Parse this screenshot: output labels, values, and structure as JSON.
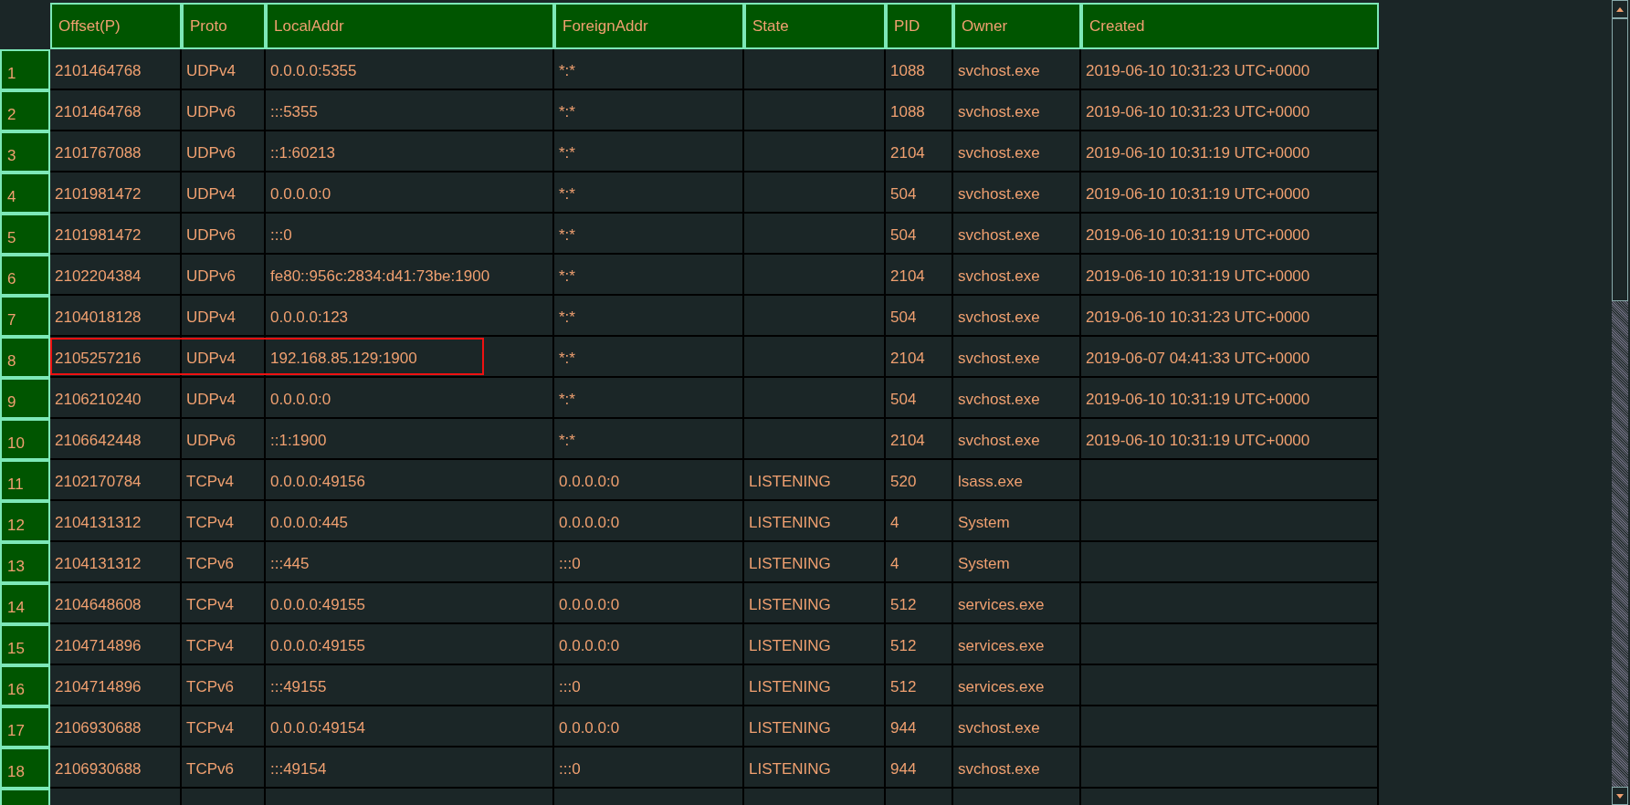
{
  "table": {
    "columns": [
      "Offset(P)",
      "Proto",
      "LocalAddr",
      "ForeignAddr",
      "State",
      "PID",
      "Owner",
      "Created"
    ],
    "rows": [
      {
        "number": "1",
        "cells": [
          "2101464768",
          "UDPv4",
          "0.0.0.0:5355",
          "*:*",
          "",
          "1088",
          "svchost.exe",
          "2019-06-10 10:31:23 UTC+0000"
        ],
        "highlighted": false
      },
      {
        "number": "2",
        "cells": [
          "2101464768",
          "UDPv6",
          ":::5355",
          "*:*",
          "",
          "1088",
          "svchost.exe",
          "2019-06-10 10:31:23 UTC+0000"
        ],
        "highlighted": false
      },
      {
        "number": "3",
        "cells": [
          "2101767088",
          "UDPv6",
          "::1:60213",
          "*:*",
          "",
          "2104",
          "svchost.exe",
          "2019-06-10 10:31:19 UTC+0000"
        ],
        "highlighted": false
      },
      {
        "number": "4",
        "cells": [
          "2101981472",
          "UDPv4",
          "0.0.0.0:0",
          "*:*",
          "",
          "504",
          "svchost.exe",
          "2019-06-10 10:31:19 UTC+0000"
        ],
        "highlighted": false
      },
      {
        "number": "5",
        "cells": [
          "2101981472",
          "UDPv6",
          ":::0",
          "*:*",
          "",
          "504",
          "svchost.exe",
          "2019-06-10 10:31:19 UTC+0000"
        ],
        "highlighted": false
      },
      {
        "number": "6",
        "cells": [
          "2102204384",
          "UDPv6",
          "fe80::956c:2834:d41:73be:1900",
          "*:*",
          "",
          "2104",
          "svchost.exe",
          "2019-06-10 10:31:19 UTC+0000"
        ],
        "highlighted": false
      },
      {
        "number": "7",
        "cells": [
          "2104018128",
          "UDPv4",
          "0.0.0.0:123",
          "*:*",
          "",
          "504",
          "svchost.exe",
          "2019-06-10 10:31:23 UTC+0000"
        ],
        "highlighted": false
      },
      {
        "number": "8",
        "cells": [
          "2105257216",
          "UDPv4",
          "192.168.85.129:1900",
          "*:*",
          "",
          "2104",
          "svchost.exe",
          "2019-06-07 04:41:33 UTC+0000"
        ],
        "highlighted": true
      },
      {
        "number": "9",
        "cells": [
          "2106210240",
          "UDPv4",
          "0.0.0.0:0",
          "*:*",
          "",
          "504",
          "svchost.exe",
          "2019-06-10 10:31:19 UTC+0000"
        ],
        "highlighted": false
      },
      {
        "number": "10",
        "cells": [
          "2106642448",
          "UDPv6",
          "::1:1900",
          "*:*",
          "",
          "2104",
          "svchost.exe",
          "2019-06-10 10:31:19 UTC+0000"
        ],
        "highlighted": false
      },
      {
        "number": "11",
        "cells": [
          "2102170784",
          "TCPv4",
          "0.0.0.0:49156",
          "0.0.0.0:0",
          "LISTENING",
          "520",
          "lsass.exe",
          ""
        ],
        "highlighted": false
      },
      {
        "number": "12",
        "cells": [
          "2104131312",
          "TCPv4",
          "0.0.0.0:445",
          "0.0.0.0:0",
          "LISTENING",
          "4",
          "System",
          ""
        ],
        "highlighted": false
      },
      {
        "number": "13",
        "cells": [
          "2104131312",
          "TCPv6",
          ":::445",
          ":::0",
          "LISTENING",
          "4",
          "System",
          ""
        ],
        "highlighted": false
      },
      {
        "number": "14",
        "cells": [
          "2104648608",
          "TCPv4",
          "0.0.0.0:49155",
          "0.0.0.0:0",
          "LISTENING",
          "512",
          "services.exe",
          ""
        ],
        "highlighted": false
      },
      {
        "number": "15",
        "cells": [
          "2104714896",
          "TCPv4",
          "0.0.0.0:49155",
          "0.0.0.0:0",
          "LISTENING",
          "512",
          "services.exe",
          ""
        ],
        "highlighted": false
      },
      {
        "number": "16",
        "cells": [
          "2104714896",
          "TCPv6",
          ":::49155",
          ":::0",
          "LISTENING",
          "512",
          "services.exe",
          ""
        ],
        "highlighted": false
      },
      {
        "number": "17",
        "cells": [
          "2106930688",
          "TCPv4",
          "0.0.0.0:49154",
          "0.0.0.0:0",
          "LISTENING",
          "944",
          "svchost.exe",
          ""
        ],
        "highlighted": false
      },
      {
        "number": "18",
        "cells": [
          "2106930688",
          "TCPv6",
          ":::49154",
          ":::0",
          "LISTENING",
          "944",
          "svchost.exe",
          ""
        ],
        "highlighted": false
      }
    ]
  }
}
